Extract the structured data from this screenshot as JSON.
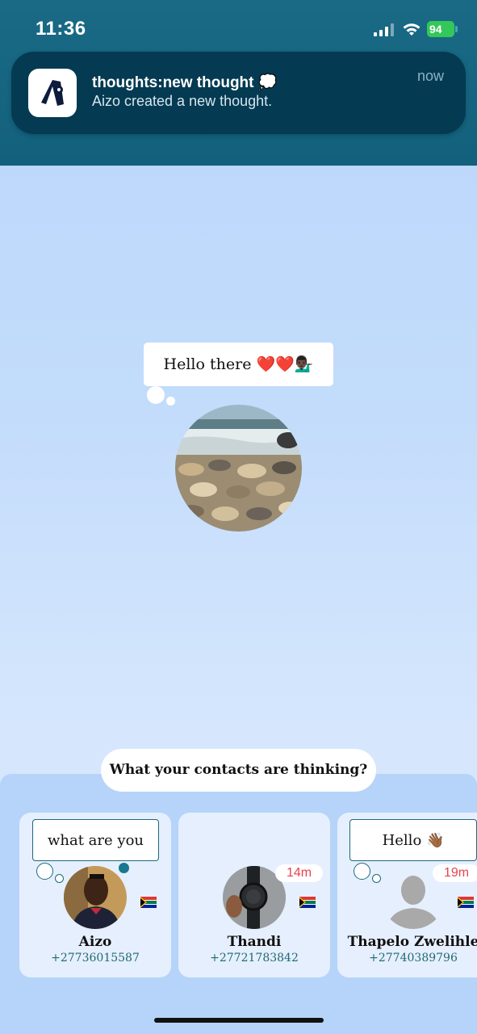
{
  "status_bar": {
    "time": "11:36",
    "battery": "94"
  },
  "notification": {
    "title": "thoughts:new thought 💭",
    "body": "Aizo created a new thought.",
    "time": "now"
  },
  "main_thought": {
    "text": "Hello there ❤️❤️💁🏿‍♂️"
  },
  "contacts_header": "What your contacts are thinking?",
  "contacts": [
    {
      "name": "Aizo",
      "phone": "+27736015587",
      "thought": "what are you",
      "time": ""
    },
    {
      "name": "Thandi",
      "phone": "+27721783842",
      "thought": "",
      "time": "14m"
    },
    {
      "name": "Thapelo Zwelihle",
      "phone": "+27740389796",
      "thought": "Hello 👋🏾",
      "time": "19m"
    }
  ],
  "colors": {
    "accent": "#1c6a7d",
    "time_badge": "#e8434f",
    "notification_bg": "#043a52"
  }
}
